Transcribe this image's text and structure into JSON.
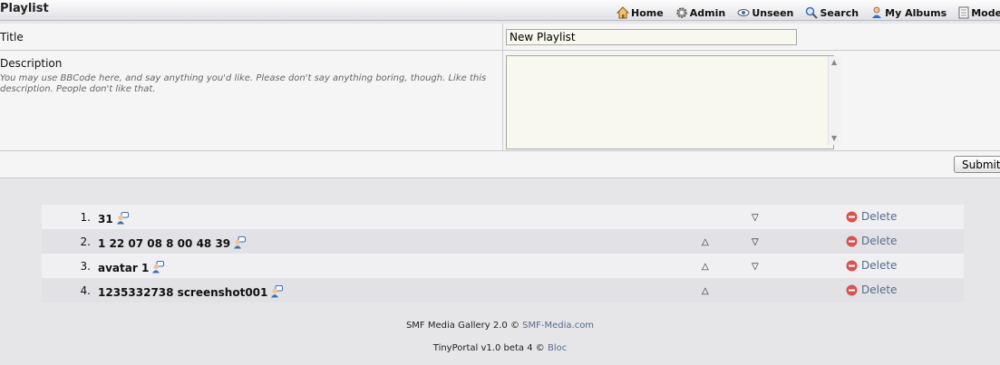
{
  "header": {
    "title": "Playlist",
    "nav": [
      {
        "label": "Home",
        "icon": "home-icon"
      },
      {
        "label": "Admin",
        "icon": "gear-icon"
      },
      {
        "label": "Unseen",
        "icon": "eye-icon"
      },
      {
        "label": "Search",
        "icon": "search-icon"
      },
      {
        "label": "My Albums",
        "icon": "user-icon"
      },
      {
        "label": "Moderation",
        "icon": "document-icon"
      }
    ]
  },
  "form": {
    "title_label": "Title",
    "title_value": "New Playlist",
    "description_label": "Description",
    "description_hint": "You may use BBCode here, and say anything you'd like. Please don't say anything boring, though. Like this description. People don't like that.",
    "submit_label": "Submit"
  },
  "playlist": {
    "items": [
      {
        "num": "1.",
        "title": "31",
        "can_up": false,
        "can_down": true,
        "delete": "Delete"
      },
      {
        "num": "2.",
        "title": "1 22 07 08 8 00 48 39",
        "can_up": true,
        "can_down": true,
        "delete": "Delete"
      },
      {
        "num": "3.",
        "title": "avatar 1",
        "can_up": true,
        "can_down": true,
        "delete": "Delete"
      },
      {
        "num": "4.",
        "title": "1235332738 screenshot001",
        "can_up": true,
        "can_down": false,
        "delete": "Delete"
      }
    ]
  },
  "footer": {
    "line1_prefix": "SMF Media Gallery 2.0 ©",
    "line1_link": "SMF-Media.com",
    "line2_prefix": "TinyPortal v1.0 beta 4 ©",
    "line2_link": "Bloc"
  },
  "colors": {
    "link": "#556b8d",
    "delete_icon": "#d9534f"
  }
}
